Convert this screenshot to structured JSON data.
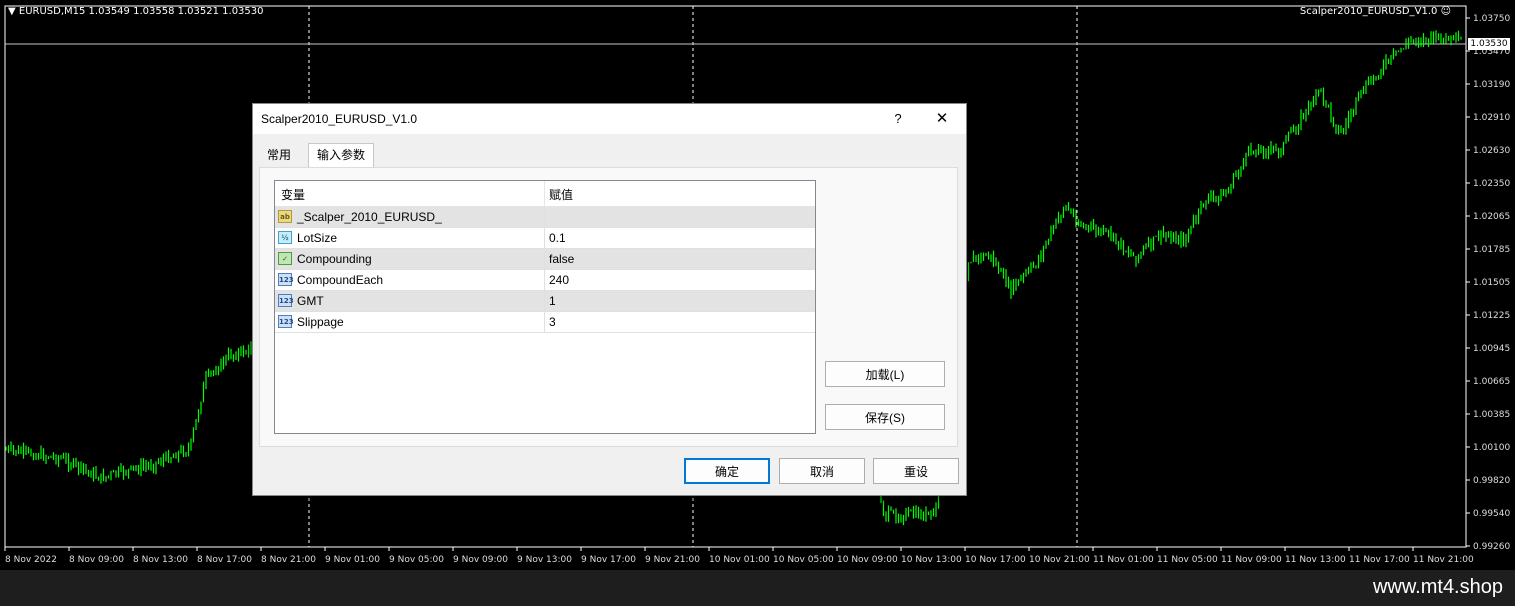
{
  "chart": {
    "header": "EURUSD,M15  1.03549 1.03558 1.03521 1.03530",
    "header_icon": "triangle-down-icon",
    "ea_name": "Scalper2010_EURUSD_V1.0",
    "ea_icon": "smiley-icon",
    "current_price": "1.03530",
    "price_levels": [
      "1.03750",
      "1.03470",
      "1.03190",
      "1.02910",
      "1.02630",
      "1.02350",
      "1.02065",
      "1.01785",
      "1.01505",
      "1.01225",
      "1.00945",
      "1.00665",
      "1.00385",
      "1.00100",
      "0.99820",
      "0.99540",
      "0.99260"
    ],
    "time_labels": [
      "8 Nov 2022",
      "8 Nov 09:00",
      "8 Nov 13:00",
      "8 Nov 17:00",
      "8 Nov 21:00",
      "9 Nov 01:00",
      "9 Nov 05:00",
      "9 Nov 09:00",
      "9 Nov 13:00",
      "9 Nov 17:00",
      "9 Nov 21:00",
      "10 Nov 01:00",
      "10 Nov 05:00",
      "10 Nov 09:00",
      "10 Nov 13:00",
      "10 Nov 17:00",
      "10 Nov 21:00",
      "11 Nov 01:00",
      "11 Nov 05:00",
      "11 Nov 09:00",
      "11 Nov 13:00",
      "11 Nov 17:00",
      "11 Nov 21:00"
    ],
    "candle_color": "#00ff00",
    "background": "#000000"
  },
  "dialog": {
    "title": "Scalper2010_EURUSD_V1.0",
    "help_label": "?",
    "close_label": "✕",
    "tabs": [
      {
        "label": "常用"
      },
      {
        "label": "输入参数"
      }
    ],
    "columns": {
      "variable": "变量",
      "value": "赋值"
    },
    "rows": [
      {
        "icon": "ab",
        "type": "string",
        "name": "_Scalper_2010_EURUSD_",
        "value": ""
      },
      {
        "icon": "½",
        "type": "double",
        "name": "LotSize",
        "value": "0.1"
      },
      {
        "icon": "✓",
        "type": "bool",
        "name": "Compounding",
        "value": "false"
      },
      {
        "icon": "123",
        "type": "int",
        "name": "CompoundEach",
        "value": "240"
      },
      {
        "icon": "123",
        "type": "int",
        "name": "GMT",
        "value": "1"
      },
      {
        "icon": "123",
        "type": "int",
        "name": "Slippage",
        "value": "3"
      }
    ],
    "buttons": {
      "load": "加载(L)",
      "save": "保存(S)",
      "ok": "确定",
      "cancel": "取消",
      "reset": "重设"
    }
  },
  "watermark": "www.mt4.shop"
}
